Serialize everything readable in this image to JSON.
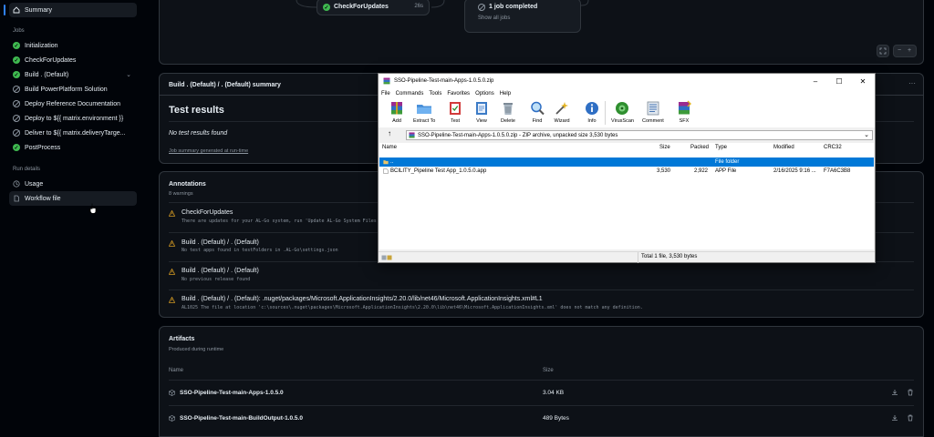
{
  "sidebar": {
    "summary": "Summary",
    "jobs_heading": "Jobs",
    "jobs": [
      {
        "label": "Initialization",
        "status": "success"
      },
      {
        "label": "CheckForUpdates",
        "status": "success"
      },
      {
        "label": "Build . (Default)",
        "status": "success"
      },
      {
        "label": "Build PowerPlatform Solution",
        "status": "skipped"
      },
      {
        "label": "Deploy Reference Documentation",
        "status": "skipped"
      },
      {
        "label": "Deploy to ${{ matrix.environment }}",
        "status": "skipped"
      },
      {
        "label": "Deliver to ${{ matrix.deliveryTarge...",
        "status": "skipped"
      },
      {
        "label": "PostProcess",
        "status": "success"
      }
    ],
    "run_details_heading": "Run details",
    "usage": "Usage",
    "workflow_file": "Workflow file"
  },
  "graph": {
    "job_name": "CheckForUpdates",
    "job_time": "26s",
    "completed_label": "1 job completed",
    "show_all": "Show all jobs"
  },
  "summary_panel": {
    "header": "Build . (Default) / . (Default) summary",
    "title": "Test results",
    "no_results": "No test results found",
    "generated": "Job summary generated at run-time"
  },
  "annotations": {
    "title": "Annotations",
    "count": "8 warnings",
    "items": [
      {
        "title": "CheckForUpdates",
        "message": "There are updates for your AL-Go system, run 'Update AL-Go System Files'"
      },
      {
        "title": "Build . (Default) / . (Default)",
        "message": "No test apps found in testFolders in .AL-Go\\settings.json"
      },
      {
        "title": "Build . (Default) / . (Default)",
        "message": "No previous release found"
      },
      {
        "title": "Build . (Default) / . (Default): .nuget/packages/Microsoft.ApplicationInsights/2.20.0/lib/net46/Microsoft.ApplicationInsights.xml#L1",
        "message": "AL1025 The file at location 'c:\\sources\\.nuget\\packages\\Microsoft.ApplicationInsights\\2.20.0\\lib\\net46\\Microsoft.ApplicationInsights.xml' does not match any definition."
      }
    ]
  },
  "artifacts": {
    "title": "Artifacts",
    "subtitle": "Produced during runtime",
    "col_name": "Name",
    "col_size": "Size",
    "rows": [
      {
        "name": "SSO-Pipeline-Test-main-Apps-1.0.5.0",
        "size": "3.04 KB"
      },
      {
        "name": "SSO-Pipeline-Test-main-BuildOutput-1.0.5.0",
        "size": "489 Bytes"
      }
    ]
  },
  "winrar": {
    "title": "SSO-Pipeline-Test-main-Apps-1.0.5.0.zip",
    "menu": [
      "File",
      "Commands",
      "Tools",
      "Favorites",
      "Options",
      "Help"
    ],
    "toolbar": [
      "Add",
      "Extract To",
      "Test",
      "View",
      "Delete",
      "Find",
      "Wizard",
      "Info",
      "VirusScan",
      "Comment",
      "SFX"
    ],
    "address": "SSO-Pipeline-Test-main-Apps-1.0.5.0.zip - ZIP archive, unpacked size 3,530 bytes",
    "columns": [
      "Name",
      "Size",
      "Packed",
      "Type",
      "Modified",
      "CRC32"
    ],
    "rows": [
      {
        "name": "..",
        "size": "",
        "packed": "",
        "type": "File folder",
        "modified": "",
        "crc": ""
      },
      {
        "name": "BCILITY_Pipeline Test App_1.0.5.0.app",
        "size": "3,530",
        "packed": "2,922",
        "type": "APP File",
        "modified": "2/16/2025 9:16 ...",
        "crc": "F7A6C3B8"
      }
    ],
    "status": "Total 1 file, 3,530 bytes"
  }
}
